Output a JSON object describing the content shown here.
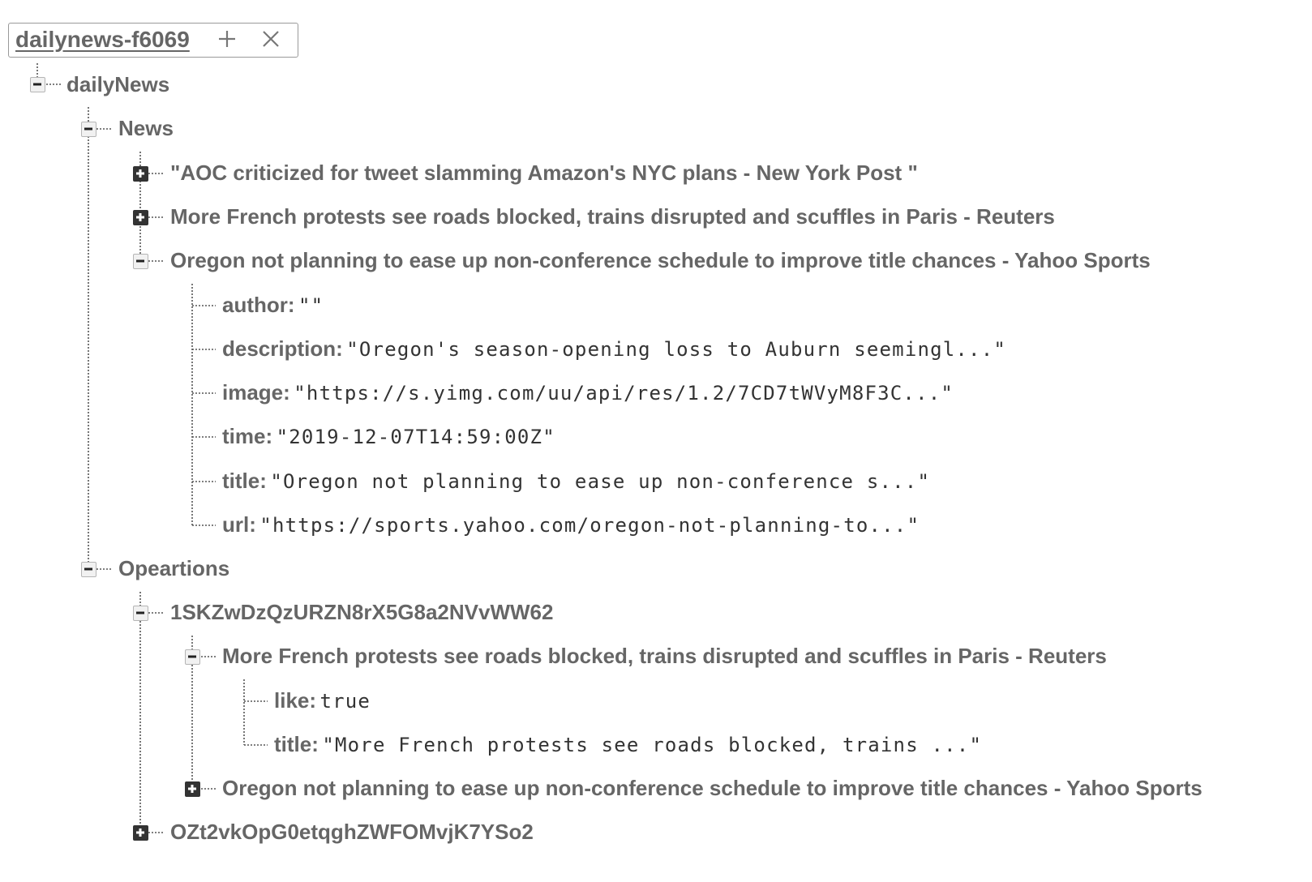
{
  "database": {
    "name": "dailynews-f6069",
    "add_icon": "plus-icon",
    "remove_icon": "close-icon"
  },
  "tree": {
    "root": "dailyNews",
    "news": {
      "label": "News",
      "items": [
        "\"AOC criticized for tweet slamming Amazon's NYC plans - New York Post \"",
        "More French protests see roads blocked, trains disrupted and scuffles in Paris - Reuters",
        "Oregon not planning to ease up non-conference schedule to improve title chances - Yahoo Sports"
      ],
      "expanded_fields": [
        {
          "key": "author:",
          "value": "\"\""
        },
        {
          "key": "description:",
          "value": "\"Oregon's season-opening loss to Auburn seemingl...\""
        },
        {
          "key": "image:",
          "value": "\"https://s.yimg.com/uu/api/res/1.2/7CD7tWVyM8F3C...\""
        },
        {
          "key": "time:",
          "value": "\"2019-12-07T14:59:00Z\""
        },
        {
          "key": "title:",
          "value": "\"Oregon not planning to ease up non-conference s...\""
        },
        {
          "key": "url:",
          "value": "\"https://sports.yahoo.com/oregon-not-planning-to...\""
        }
      ]
    },
    "operations": {
      "label": "Opeartions",
      "users": [
        {
          "id": "1SKZwDzQzURZN8rX5G8a2NVvWW62",
          "items": [
            {
              "label": "More French protests see roads blocked, trains disrupted and scuffles in Paris - Reuters",
              "fields": [
                {
                  "key": "like:",
                  "value": "true"
                },
                {
                  "key": "title:",
                  "value": "\"More French protests see roads blocked, trains ...\""
                }
              ]
            },
            {
              "label": "Oregon not planning to ease up non-conference schedule to improve title chances - Yahoo Sports"
            }
          ]
        },
        {
          "id": "OZt2vkOpG0etqghZWFOMvjK7YSo2"
        }
      ]
    }
  }
}
